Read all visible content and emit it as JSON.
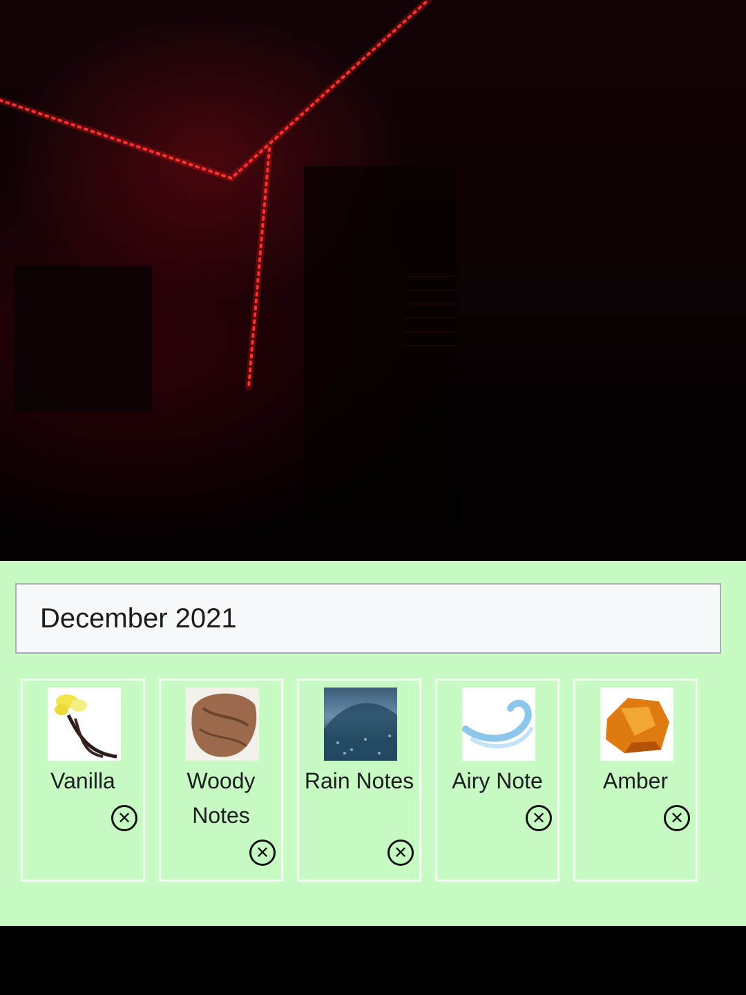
{
  "date_field": {
    "value": "December 2021"
  },
  "notes": [
    {
      "label": "Vanilla",
      "icon": "vanilla-flower-image"
    },
    {
      "label": "Woody Notes",
      "icon": "wood-image"
    },
    {
      "label": "Rain Notes",
      "icon": "rain-image"
    },
    {
      "label": "Airy Note",
      "icon": "air-swirl-image"
    },
    {
      "label": "Amber",
      "icon": "amber-stone-image"
    }
  ],
  "colors": {
    "panel": "#c8fbc4",
    "led": "#ff2a2a"
  }
}
